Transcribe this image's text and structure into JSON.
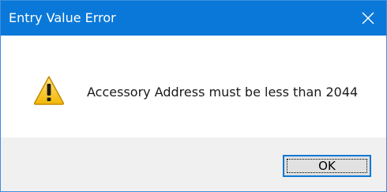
{
  "window": {
    "title": "Entry Value Error"
  },
  "dialog": {
    "icon": "warning-icon",
    "message": "Accessory Address must be less than 2044",
    "ok_label": "OK"
  },
  "colors": {
    "titlebar": "#0a78d8",
    "footer": "#f0f0f0",
    "warning_fill": "#f7c21c"
  }
}
